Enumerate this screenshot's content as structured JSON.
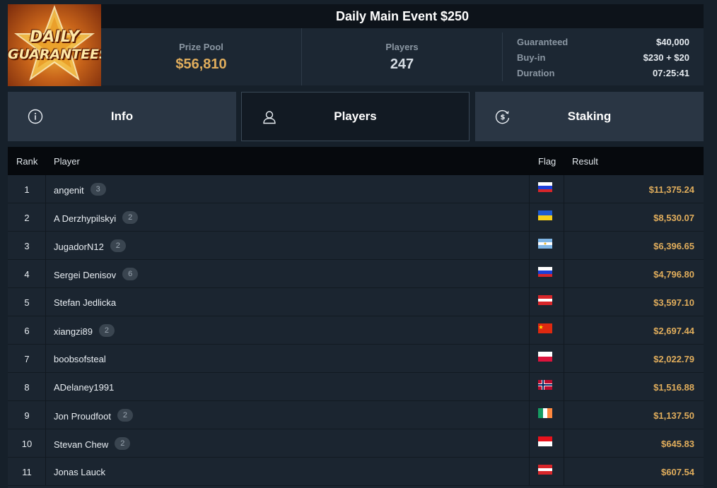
{
  "logo": {
    "line1": "DAILY",
    "line2": "GUARANTEES"
  },
  "header": {
    "title": "Daily Main Event $250",
    "prize_pool_label": "Prize Pool",
    "prize_pool_value": "$56,810",
    "players_label": "Players",
    "players_value": "247",
    "details": [
      {
        "label": "Guaranteed",
        "value": "$40,000"
      },
      {
        "label": "Buy-in",
        "value": "$230 + $20"
      },
      {
        "label": "Duration",
        "value": "07:25:41"
      }
    ]
  },
  "tabs": [
    {
      "label": "Info",
      "icon": "info-icon",
      "active": false
    },
    {
      "label": "Players",
      "icon": "user-icon",
      "active": true
    },
    {
      "label": "Staking",
      "icon": "dollar-coin-icon",
      "active": false
    }
  ],
  "table": {
    "columns": {
      "rank": "Rank",
      "player": "Player",
      "flag": "Flag",
      "result": "Result"
    },
    "rows": [
      {
        "rank": "1",
        "player": "angenit",
        "badge": "3",
        "flag": "russia",
        "result": "$11,375.24"
      },
      {
        "rank": "2",
        "player": "A Derzhypilskyi",
        "badge": "2",
        "flag": "ukraine",
        "result": "$8,530.07"
      },
      {
        "rank": "3",
        "player": "JugadorN12",
        "badge": "2",
        "flag": "argentina",
        "result": "$6,396.65"
      },
      {
        "rank": "4",
        "player": "Sergei Denisov",
        "badge": "6",
        "flag": "russia",
        "result": "$4,796.80"
      },
      {
        "rank": "5",
        "player": "Stefan Jedlicka",
        "badge": "",
        "flag": "austria",
        "result": "$3,597.10"
      },
      {
        "rank": "6",
        "player": "xiangzi89",
        "badge": "2",
        "flag": "china",
        "result": "$2,697.44"
      },
      {
        "rank": "7",
        "player": "boobsofsteal",
        "badge": "",
        "flag": "poland",
        "result": "$2,022.79"
      },
      {
        "rank": "8",
        "player": "ADelaney1991",
        "badge": "",
        "flag": "norway",
        "result": "$1,516.88"
      },
      {
        "rank": "9",
        "player": "Jon Proudfoot",
        "badge": "2",
        "flag": "ireland",
        "result": "$1,137.50"
      },
      {
        "rank": "10",
        "player": "Stevan Chew",
        "badge": "2",
        "flag": "indonesia",
        "result": "$645.83"
      },
      {
        "rank": "11",
        "player": "Jonas Lauck",
        "badge": "",
        "flag": "austria",
        "result": "$607.54"
      }
    ]
  },
  "colors": {
    "accent_gold": "#e0ad5c",
    "background": "#16202a",
    "panel": "#1c2733",
    "tab": "#2a3644"
  }
}
